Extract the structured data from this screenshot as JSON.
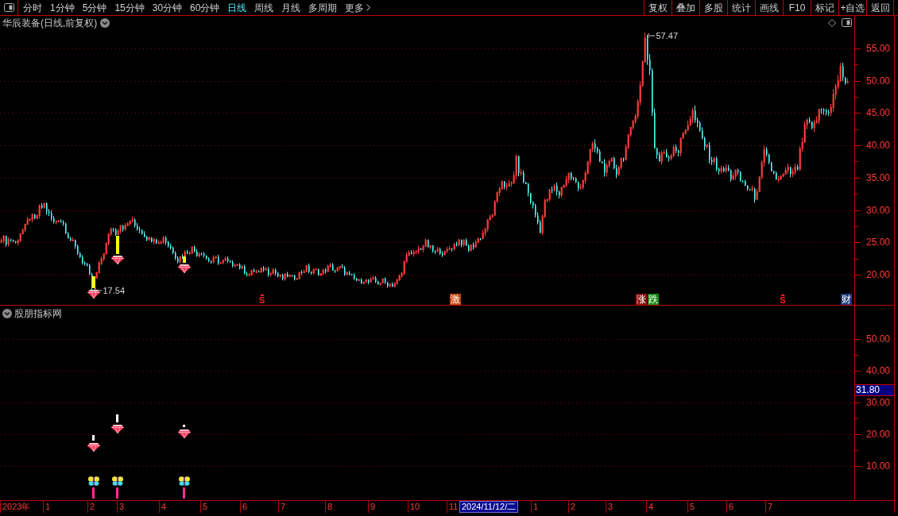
{
  "toolbar": {
    "periods": [
      {
        "label": "分时",
        "selected": false
      },
      {
        "label": "1分钟",
        "selected": false
      },
      {
        "label": "5分钟",
        "selected": false
      },
      {
        "label": "15分钟",
        "selected": false
      },
      {
        "label": "30分钟",
        "selected": false
      },
      {
        "label": "60分钟",
        "selected": false
      },
      {
        "label": "日线",
        "selected": true
      },
      {
        "label": "周线",
        "selected": false
      },
      {
        "label": "月线",
        "selected": false
      },
      {
        "label": "多周期",
        "selected": false
      }
    ],
    "more_menu": {
      "label": "更多"
    },
    "actions": [
      "复权",
      "叠加",
      "多股",
      "统计",
      "画线",
      "F10",
      "标记",
      "+自选",
      "返回"
    ]
  },
  "main_panel": {
    "title": "华辰装备(日线,前复权)",
    "price_axis": [
      "55.00",
      "50.00",
      "45.00",
      "40.00",
      "35.00",
      "30.00",
      "25.00",
      "20.00"
    ],
    "high_label": "57.47",
    "low_label": "17.54",
    "events": [
      {
        "kind": "mark",
        "label": "S",
        "color": "#ff2020"
      },
      {
        "kind": "badge",
        "label": "激",
        "color": "#c04a10"
      },
      {
        "kind": "badge",
        "label": "涨",
        "color": "#8a1010"
      },
      {
        "kind": "badge",
        "label": "跌",
        "color": "#1a8a1a"
      },
      {
        "kind": "mark",
        "label": "S",
        "color": "#ff2020"
      },
      {
        "kind": "badge",
        "label": "财",
        "color": "#1c3c78"
      }
    ]
  },
  "indicator_panel": {
    "title": "股朋指标网",
    "value_axis": [
      "50.00",
      "40.00",
      "30.00",
      "20.00",
      "10.00"
    ],
    "cursor_value": "31.80"
  },
  "date_axis": {
    "labels": [
      "2023年",
      "1",
      "2",
      "3",
      "4",
      "5",
      "6",
      "7",
      "8",
      "9",
      "10",
      "11",
      "1",
      "2",
      "3",
      "4",
      "5",
      "6",
      "7"
    ],
    "cursor_date": "2024/11/12/二"
  }
}
